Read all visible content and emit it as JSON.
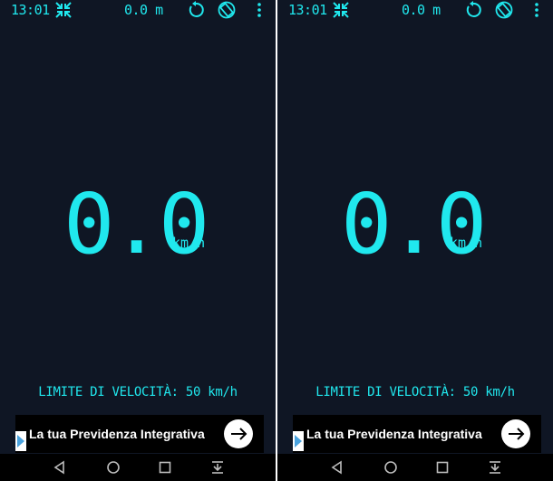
{
  "screens": [
    {
      "status": {
        "time": "13:01",
        "distance": "0.0 m"
      },
      "speed": {
        "value": "0.0",
        "unit": "km/h"
      },
      "speed_limit": "LIMITE DI VELOCITÀ: 50 km/h",
      "ad": {
        "text": "La tua Previdenza Integrativa"
      }
    },
    {
      "status": {
        "time": "13:01",
        "distance": "0.0 m"
      },
      "speed": {
        "value": "0.0",
        "unit": "km/h"
      },
      "speed_limit": "LIMITE DI VELOCITÀ: 50 km/h",
      "ad": {
        "text": "La tua Previdenza Integrativa"
      }
    }
  ],
  "icons": {
    "compress": "compress-arrows-icon",
    "reset": "reset-icon",
    "rotate": "screen-rotation-icon",
    "menu": "more-vert-icon",
    "ad_badge": "adchoices-icon",
    "ad_arrow": "arrow-right-icon",
    "nav_back": "back-triangle-icon",
    "nav_home": "home-circle-icon",
    "nav_recent": "recent-square-icon",
    "nav_notif": "notification-pull-icon"
  },
  "colors": {
    "display": "#20e8ee",
    "background": "#0f1624",
    "ad_background": "#000000",
    "navbar": "#000000"
  }
}
